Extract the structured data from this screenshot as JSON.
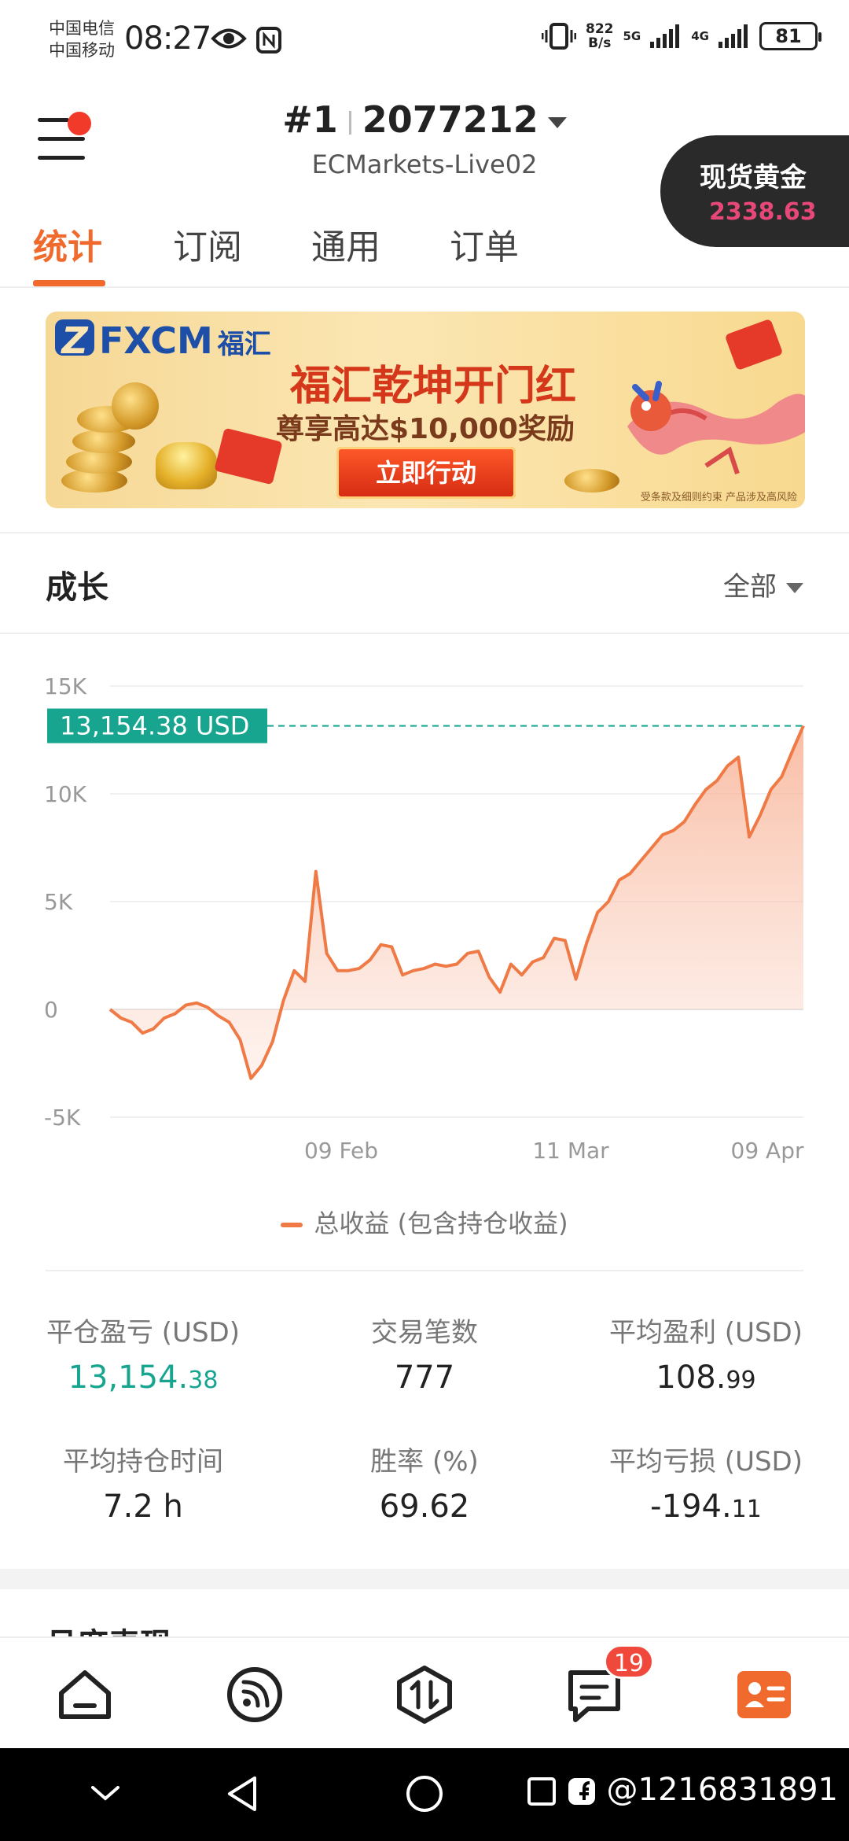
{
  "status_bar": {
    "carrier_1": "中国电信",
    "carrier_2": "中国移动",
    "time": "08:27",
    "speed_value": "822",
    "speed_unit": "B/s",
    "net_1": "5G",
    "net_2": "4G",
    "battery": "81"
  },
  "header": {
    "rank": "#1",
    "account_number": "2077212",
    "server": "ECMarkets-Live02",
    "ticker": {
      "name": "现货黄金",
      "price": "2338.63"
    }
  },
  "tabs": [
    {
      "label": "统计",
      "active": true
    },
    {
      "label": "订阅",
      "active": false
    },
    {
      "label": "通用",
      "active": false
    },
    {
      "label": "订单",
      "active": false
    }
  ],
  "banner": {
    "brand": "FXCM",
    "brand_cn": "福汇",
    "title": "福汇乾坤开门红",
    "subtitle": "尊享高达$10,000奖励",
    "cta": "立即行动",
    "fine_print": "受条款及细则约束  产品涉及高风险"
  },
  "growth": {
    "title": "成长",
    "filter": "全部",
    "legend": "总收益 (包含持仓收益)"
  },
  "chart_data": {
    "type": "area",
    "title": "",
    "xlabel": "",
    "ylabel": "",
    "x_ticks": [
      "09 Feb",
      "11 Mar",
      "09 Apr"
    ],
    "y_ticks": [
      "15K",
      "10K",
      "5K",
      "0",
      "-5K"
    ],
    "ylim": [
      -5000,
      15000
    ],
    "current_value_label": "13,154.38 USD",
    "current_value": 13154.38,
    "series": [
      {
        "name": "总收益 (包含持仓收益)",
        "color": "#ef7a45",
        "values": [
          0,
          -400,
          -600,
          -1100,
          -900,
          -400,
          -200,
          200,
          300,
          100,
          -300,
          -600,
          -1400,
          -3200,
          -2600,
          -1500,
          400,
          1800,
          1300,
          6400,
          2600,
          1800,
          1800,
          1900,
          2300,
          3000,
          2900,
          1600,
          1800,
          1900,
          2100,
          2000,
          2100,
          2600,
          2700,
          1500,
          800,
          2100,
          1600,
          2200,
          2400,
          3300,
          3200,
          1400,
          3100,
          4500,
          5000,
          6000,
          6300,
          6900,
          7500,
          8100,
          8300,
          8700,
          9500,
          10200,
          10600,
          11300,
          11700,
          8000,
          9000,
          10200,
          10800,
          12000,
          13154.38
        ]
      }
    ],
    "grid": true
  },
  "stats": [
    {
      "label": "平仓盈亏 (USD)",
      "value_main": "13,154.",
      "value_small": "38",
      "color": "#17a58f"
    },
    {
      "label": "交易笔数",
      "value_main": "777",
      "value_small": "",
      "color": "#222222"
    },
    {
      "label": "平均盈利 (USD)",
      "value_main": "108.",
      "value_small": "99",
      "color": "#222222"
    },
    {
      "label": "平均持仓时间",
      "value_main": "7.2 h",
      "value_small": "",
      "color": "#222222"
    },
    {
      "label": "胜率 (%)",
      "value_main": "69.62",
      "value_small": "",
      "color": "#222222"
    },
    {
      "label": "平均亏损 (USD)",
      "value_main": "-194.",
      "value_small": "11",
      "color": "#222222"
    }
  ],
  "next_section": {
    "title": "月度表现"
  },
  "bottom_nav": {
    "items": [
      "home-icon",
      "feed-icon",
      "trade-icon",
      "messages-icon",
      "profile-card-icon"
    ],
    "messages_badge": "19",
    "active_color": "#ef6a2c"
  },
  "system_bar": {
    "handle": "@1216831891"
  }
}
